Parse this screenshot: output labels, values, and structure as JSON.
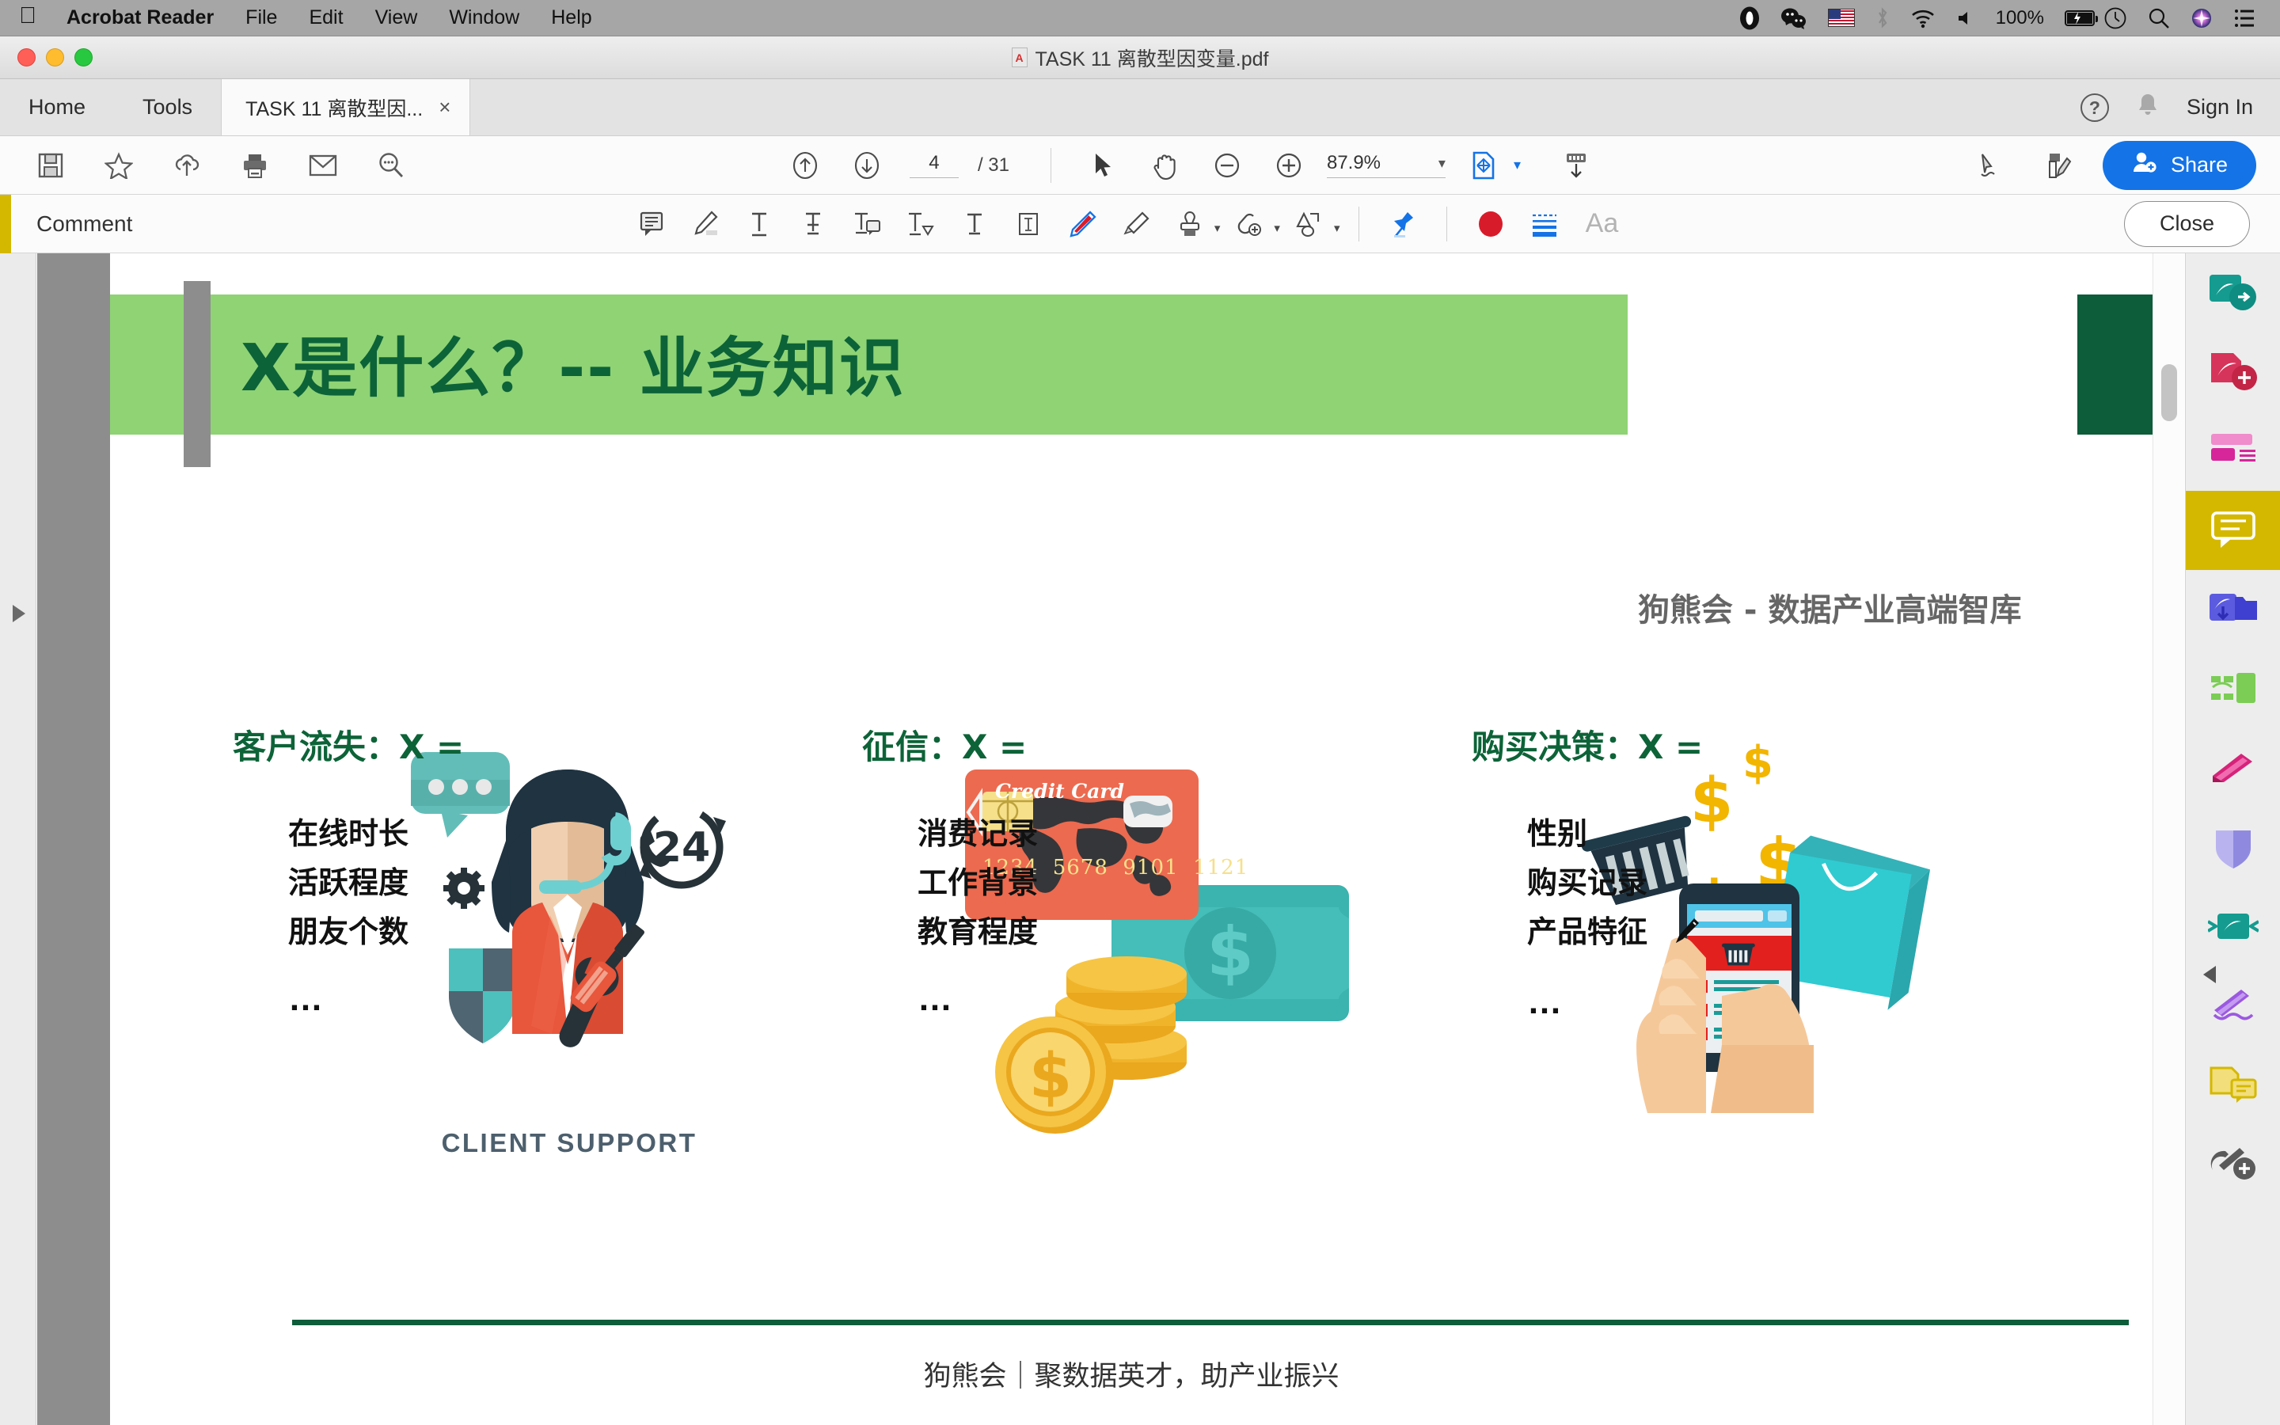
{
  "menubar": {
    "apple_icon": "apple-icon",
    "items": [
      {
        "label": "Acrobat Reader",
        "bold": true
      },
      {
        "label": "File"
      },
      {
        "label": "Edit"
      },
      {
        "label": "View"
      },
      {
        "label": "Window"
      },
      {
        "label": "Help"
      }
    ],
    "status": {
      "battery_percent": "100%",
      "icons": [
        "opera-icon",
        "wechat-icon",
        "us-flag-icon",
        "bluetooth-icon",
        "wifi-icon",
        "volume-icon",
        "battery-charging-icon",
        "timemachine-icon",
        "spotlight-search-icon",
        "siri-icon",
        "control-center-icon"
      ]
    }
  },
  "window": {
    "document_title": "TASK 11 离散型因变量.pdf",
    "traffic_lights": [
      "close",
      "minimize",
      "zoom"
    ]
  },
  "tabstrip": {
    "home_label": "Home",
    "tools_label": "Tools",
    "doc_tab_label": "TASK 11 离散型因...",
    "close_tab_label": "×",
    "help_label": "?",
    "bell_icon": "notification-bell-icon",
    "sign_in_label": "Sign In"
  },
  "toolbar": {
    "left_icons": [
      "save-icon",
      "star-icon",
      "cloud-upload-icon",
      "print-icon",
      "email-icon",
      "search-icon"
    ],
    "prev_page_icon": "arrow-up-circle-icon",
    "next_page_icon": "arrow-down-circle-icon",
    "current_page": "4",
    "page_total": "/ 31",
    "select_tool_icon": "cursor-arrow-icon",
    "hand_tool_icon": "hand-icon",
    "zoom_out_icon": "zoom-out-icon",
    "zoom_in_icon": "zoom-in-icon",
    "zoom_value": "87.9%",
    "zoom_caret": "▾",
    "fit_page_icon": "fit-page-icon",
    "fit_caret": "▾",
    "scroll_mode_icon": "scroll-mode-icon",
    "sign_icon": "fill-and-sign-icon",
    "edit_pdf_icon": "edit-pdf-icon",
    "share_label": "Share",
    "share_icon": "share-person-icon",
    "share_color": "#1473e6"
  },
  "commentbar": {
    "accent_color": "#d4b800",
    "title": "Comment",
    "tools": [
      {
        "name": "sticky-note-icon",
        "glyph": "note"
      },
      {
        "name": "highlight-text-icon",
        "glyph": "marker"
      },
      {
        "name": "underline-text-icon",
        "glyph": "T"
      },
      {
        "name": "strikethrough-text-icon",
        "glyph": "T"
      },
      {
        "name": "add-note-to-text-icon",
        "glyph": "T"
      },
      {
        "name": "insert-text-icon",
        "glyph": "T"
      },
      {
        "name": "text-comment-icon",
        "glyph": "T"
      },
      {
        "name": "text-box-icon",
        "glyph": "T"
      },
      {
        "name": "draw-freeform-icon",
        "glyph": "pencil"
      },
      {
        "name": "erase-drawing-icon",
        "glyph": "eraser"
      },
      {
        "name": "stamp-icon",
        "glyph": "stamp",
        "caret": "▾"
      },
      {
        "name": "attach-file-icon",
        "glyph": "clip",
        "caret": "▾"
      },
      {
        "name": "drawing-tools-icon",
        "glyph": "shapes",
        "caret": "▾"
      },
      {
        "name": "keep-tool-selected-icon",
        "glyph": "pin"
      },
      {
        "name": "color-swatch-icon",
        "glyph": "circle",
        "color": "#d81b2a"
      },
      {
        "name": "line-thickness-icon",
        "glyph": "lines",
        "color": "#1473e6"
      },
      {
        "name": "text-properties-icon",
        "glyph": "Aa"
      }
    ],
    "close_label": "Close"
  },
  "sidebar": {
    "tools": [
      {
        "name": "export-pdf-tool",
        "color": "#1b8a7e"
      },
      {
        "name": "create-pdf-tool",
        "color": "#d6345a"
      },
      {
        "name": "organize-pages-tool",
        "color": "#d6269a"
      },
      {
        "name": "comment-tool",
        "color": "#ffffff",
        "active": true
      },
      {
        "name": "combine-files-tool",
        "color": "#4a4ad6"
      },
      {
        "name": "compress-pdf-tool",
        "color": "#6cc24a"
      },
      {
        "name": "redact-tool",
        "color": "#cf1b6b"
      },
      {
        "name": "protect-tool",
        "color": "#8f8ae0"
      },
      {
        "name": "send-for-comments-tool",
        "color": "#1b8a7e"
      },
      {
        "name": "fill-and-sign-tool",
        "color": "#8e44d6"
      },
      {
        "name": "request-e-signatures-tool",
        "color": "#d4b800"
      },
      {
        "name": "more-tools",
        "color": "#5a5a5a"
      }
    ],
    "collapse_icon": "collapse-panel-icon",
    "expand_icon": "expand-panel-icon",
    "active_color": "#d4b800"
  },
  "slide": {
    "title": "X是什么？-- 业务知识",
    "brand_right": "狗熊会 - 数据产业高端智库",
    "header_bg": "#8fd375",
    "title_color": "#0d6338",
    "accent_dark": "#0d5c3a",
    "columns": [
      {
        "heading": "客户流失：X =",
        "items": [
          "在线时长",
          "活跃程度",
          "朋友个数"
        ],
        "ellipsis": "…",
        "illustration": "client-support-illustration",
        "illustration_caption": "CLIENT SUPPORT"
      },
      {
        "heading": "征信：X =",
        "items": [
          "消费记录",
          "工作背景",
          "教育程度"
        ],
        "ellipsis": "…",
        "illustration": "credit-card-money-illustration",
        "card_label": "Credit Card",
        "card_number": "1234  5678  9101  1121"
      },
      {
        "heading": "购买决策：X =",
        "items": [
          "性别",
          "购买记录",
          "产品特征"
        ],
        "ellipsis": "…",
        "illustration": "mobile-shopping-illustration",
        "cursor_on_item": 2,
        "cursor_icon": "pencil-cursor-icon"
      }
    ],
    "footer": "狗熊会｜聚数据英才，助产业振兴"
  }
}
